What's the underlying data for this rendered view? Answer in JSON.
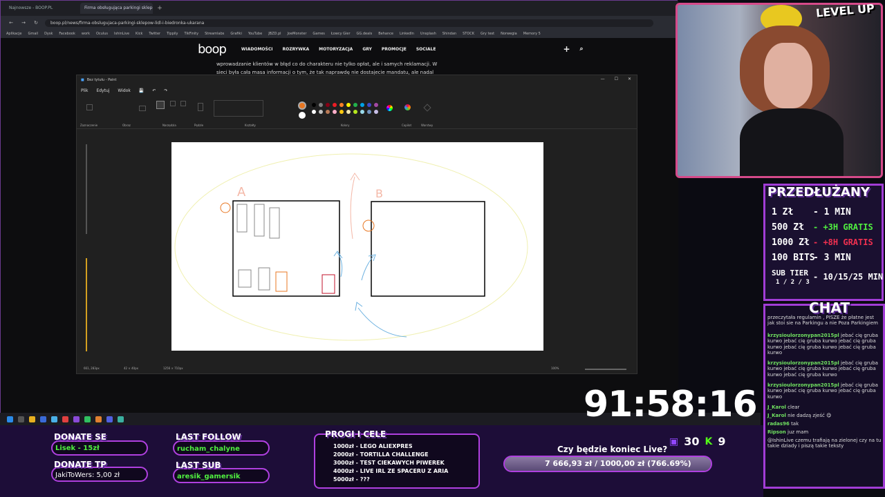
{
  "browser": {
    "tabs": [
      {
        "label": "Najnowsze - BOOP.PL",
        "active": false
      },
      {
        "label": "Firma obsługująca parkingi sklepów Lidl",
        "active": true
      }
    ],
    "url": "boop.pl/news/firma-obslugujaca-parkingi-sklepow-lidl-i-biedronka-ukarana",
    "bookmarks": [
      "Aplikacje",
      "Gmail",
      "Dysk",
      "Facebook",
      "work",
      "Oculus",
      "IshinLive",
      "Kick",
      "Twitter",
      "Tippily",
      "TikFinity",
      "Streamlabs",
      "Grafiki",
      "YouTube",
      "JBZD.pl",
      "JoeMonster",
      "Games",
      "Łowcy Gier",
      "GG.deals",
      "Behance",
      "LinkedIn",
      "Unsplash",
      "Shindan",
      "STOCK",
      "Gry test",
      "Norwegia",
      "Memory 5"
    ]
  },
  "site": {
    "logo": "boop",
    "nav": [
      "WIADOMOŚCI",
      "ROZRYWKA",
      "MOTORYZACJA",
      "GRY",
      "PROMOCJE",
      "SOCIALE"
    ],
    "article": "wprowadzanie klientów w błąd co do charakteru nie tylko opłat, ale i samych reklamacji. W sieci była cała masa informacji o tym, że tak naprawdę nie dostajecie mandatu, ale nadal"
  },
  "paint": {
    "title": "Bez tytułu - Paint",
    "menu": [
      "Plik",
      "Edytuj",
      "Widok"
    ],
    "groups": [
      "Zaznaczenie",
      "Obraz",
      "Narzędzia",
      "Pędzle",
      "Kształty",
      "Kolory",
      "Copilot",
      "Warstwy"
    ],
    "status": {
      "cursor": "661, 283px",
      "selection": "42 × 40px",
      "size": "1256 × 710px",
      "zoom": "100%"
    },
    "palette": [
      "#000000",
      "#7f7f7f",
      "#880015",
      "#ed1c24",
      "#ff7f27",
      "#fff200",
      "#22b14c",
      "#00a2e8",
      "#3f48cc",
      "#a349a4",
      "#ffffff",
      "#c3c3c3",
      "#b97a57",
      "#ffaec9",
      "#ffc90e",
      "#efe4b0",
      "#b5e61d",
      "#99d9ea",
      "#7092be",
      "#c8bfe7"
    ],
    "primary_color": "#e87722",
    "drawing_labels": [
      "A",
      "B"
    ]
  },
  "webcam": {
    "badge": "LEVEL UP"
  },
  "subathon": {
    "title": "PRZEDŁUŻANY",
    "rows": [
      {
        "left": "1 Zł",
        "right": "- 1 MIN"
      },
      {
        "left": "500 Zł",
        "right": "- +3H GRATIS"
      },
      {
        "left": "1000 Zł",
        "right": "- +8H GRATIS"
      },
      {
        "left": "100 BITS",
        "right": "- 3 MIN"
      },
      {
        "left": "SUB TIER",
        "sub": "1 / 2 / 3",
        "right": "- 10/15/25 MIN"
      }
    ]
  },
  "chat": {
    "title": "CHAT",
    "messages": [
      {
        "user": "",
        "text": "przeczytała regulamin , PISZE że płatne jest jak stoi sie na Parkingu a nie Poza Parkingiem"
      },
      {
        "user": "krzysioulorzonypan2015pl",
        "text": "jebać cię gruba kurwo jebać cię gruba kurwo jebać cię gruba kurwo jebać cię gruba kurwo jebać cię gruba kurwo"
      },
      {
        "user": "krzysioulorzonypan2015pl",
        "text": "jebać cię gruba kurwo jebać cię gruba kurwo jebać cię gruba kurwo jebać cię gruba kurwo"
      },
      {
        "user": "krzysioulorzonypan2015pl",
        "text": "jebać cię gruba kurwo jebać cię gruba kurwo jebać cię gruba kurwo"
      },
      {
        "user": "J_Karol",
        "text": "clear"
      },
      {
        "user": "J_Karol",
        "text": "nie dadzą zjeść 😋"
      },
      {
        "user": "radas96",
        "text": "tak"
      },
      {
        "user": "Ripson",
        "text": "juz mam"
      },
      {
        "user": "",
        "text": "@IshinLive czemu trafiają na zielonej czy na tu takie dziady i piszą takie teksty"
      }
    ]
  },
  "timer": "91:58:16",
  "bottom": {
    "donate_se_label": "DONATE SE",
    "donate_se_value": "Lisek - 15zł",
    "donate_tp_label": "DONATE TP",
    "donate_tp_value": "JakiToWers: 5,00 zł",
    "last_follow_label": "LAST FOLLOW",
    "last_follow_value": "rucham_chalyne",
    "last_sub_label": "LAST SUB",
    "last_sub_value": "aresik_gamersik",
    "goals_title": "PROGI I CELE",
    "goals": [
      "1000zł - LEGO ALIEXPRES",
      "2000zł - TORTILLA CHALLENGE",
      "3000zł - TEST CIEKAWYCH PIWEREK",
      "4000zł - LIVE IRL ZE SPACERU Z ARIA",
      "5000zł - ???"
    ],
    "question": "Czy będzie koniec Live?",
    "progress_text": "7 666,93 zł / 1000,00 zł (766.69%)",
    "progress": 1.0,
    "viewers": "30",
    "kicks": "9"
  }
}
